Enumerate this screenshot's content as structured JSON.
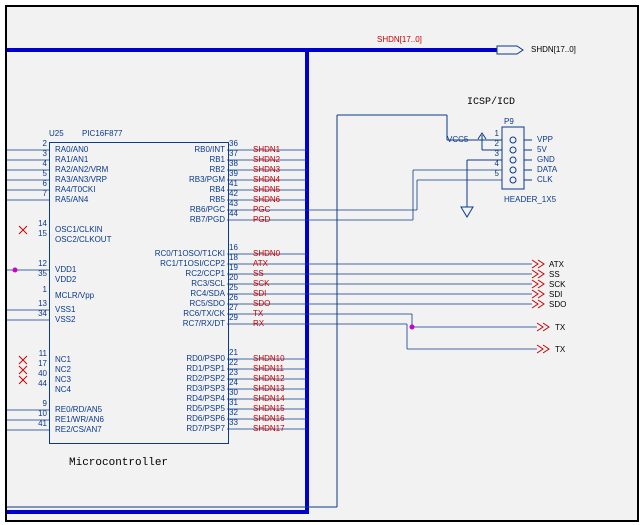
{
  "schematic": {
    "bus_label": "SHDN[17..0]",
    "bus_port": "SHDN[17..0]",
    "ic": {
      "ref": "U25",
      "part": "PIC16F877",
      "title": "Microcontroller",
      "left_pins": [
        {
          "num": "2",
          "name": "RA0/AN0"
        },
        {
          "num": "3",
          "name": "RA1/AN1"
        },
        {
          "num": "4",
          "name": "RA2/AN2/VRM"
        },
        {
          "num": "5",
          "name": "RA3/AN3/VRP"
        },
        {
          "num": "6",
          "name": "RA4/T0CKI"
        },
        {
          "num": "7",
          "name": "RA5/AN4"
        },
        {
          "num": "14",
          "name": "OSC1/CLKIN"
        },
        {
          "num": "15",
          "name": "OSC2/CLKOUT"
        },
        {
          "num": "12",
          "name": "VDD1"
        },
        {
          "num": "35",
          "name": "VDD2"
        },
        {
          "num": "1",
          "name": "MCLR/Vpp"
        },
        {
          "num": "13",
          "name": "VSS1"
        },
        {
          "num": "34",
          "name": "VSS2"
        },
        {
          "num": "11",
          "name": "NC1"
        },
        {
          "num": "17",
          "name": "NC2"
        },
        {
          "num": "40",
          "name": "NC3"
        },
        {
          "num": "44",
          "name": "NC4"
        },
        {
          "num": "9",
          "name": "RE0/RD/AN5"
        },
        {
          "num": "10",
          "name": "RE1/WR/AN6"
        },
        {
          "num": "41",
          "name": "RE2/CS/AN7"
        }
      ],
      "right_group1": [
        {
          "num": "36",
          "name": "RB0/INT",
          "net": "SHDN1"
        },
        {
          "num": "37",
          "name": "RB1",
          "net": "SHDN2"
        },
        {
          "num": "38",
          "name": "RB2",
          "net": "SHDN3"
        },
        {
          "num": "39",
          "name": "RB3/PGM",
          "net": "SHDN4"
        },
        {
          "num": "41",
          "name": "RB4",
          "net": "SHDN5"
        },
        {
          "num": "42",
          "name": "RB5",
          "net": "SHDN6"
        },
        {
          "num": "43",
          "name": "RB6/PGC",
          "net": "PGC"
        },
        {
          "num": "44",
          "name": "RB7/PGD",
          "net": "PGD"
        }
      ],
      "right_group2": [
        {
          "num": "16",
          "name": "RC0/T1OSO/T1CKI",
          "net": "SHDN0"
        },
        {
          "num": "18",
          "name": "RC1/T1OSI/CCP2",
          "net": "ATX"
        },
        {
          "num": "19",
          "name": "RC2/CCP1",
          "net": "SS"
        },
        {
          "num": "20",
          "name": "RC3/SCL",
          "net": "SCK"
        },
        {
          "num": "25",
          "name": "RC4/SDA",
          "net": "SDI"
        },
        {
          "num": "26",
          "name": "RC5/SDO",
          "net": "SDO"
        },
        {
          "num": "27",
          "name": "RC6/TX/CK",
          "net": "TX"
        },
        {
          "num": "29",
          "name": "RC7/RX/DT",
          "net": "RX"
        }
      ],
      "right_group3": [
        {
          "num": "21",
          "name": "RD0/PSP0",
          "net": "SHDN10"
        },
        {
          "num": "22",
          "name": "RD1/PSP1",
          "net": "SHDN11"
        },
        {
          "num": "23",
          "name": "RD2/PSP2",
          "net": "SHDN12"
        },
        {
          "num": "24",
          "name": "RD3/PSP3",
          "net": "SHDN13"
        },
        {
          "num": "30",
          "name": "RD4/PSP4",
          "net": "SHDN14"
        },
        {
          "num": "31",
          "name": "RD5/PSP5",
          "net": "SHDN15"
        },
        {
          "num": "32",
          "name": "RD6/PSP6",
          "net": "SHDN16"
        },
        {
          "num": "33",
          "name": "RD7/PSP7",
          "net": "SHDN17"
        }
      ]
    },
    "header": {
      "title": "ICSP/ICD",
      "ref": "P9",
      "part": "HEADER_1X5",
      "vcc": "VCC5",
      "pins": [
        {
          "num": "1",
          "name": "VPP"
        },
        {
          "num": "2",
          "name": "5V"
        },
        {
          "num": "3",
          "name": "GND"
        },
        {
          "num": "4",
          "name": "DATA"
        },
        {
          "num": "5",
          "name": "CLK"
        }
      ]
    },
    "ports": [
      "ATX",
      "SS",
      "SCK",
      "SDI",
      "SDO",
      "TX",
      "TX"
    ]
  }
}
